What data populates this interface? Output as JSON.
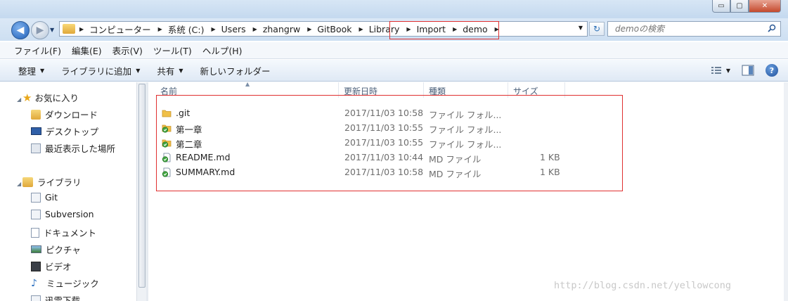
{
  "window": {
    "min_glyph": "▭",
    "max_glyph": "▢",
    "close_glyph": "✕"
  },
  "nav": {
    "back_glyph": "◀",
    "forward_glyph": "▶",
    "history_glyph": "▼",
    "refresh_glyph": "↻"
  },
  "address": {
    "crumbs": [
      "コンピューター",
      "系统 (C:)",
      "Users",
      "zhangrw",
      "GitBook",
      "Library",
      "Import",
      "demo"
    ],
    "dropdown_glyph": "▼"
  },
  "search": {
    "placeholder": "demoの検索"
  },
  "menu": [
    "ファイル(F)",
    "編集(E)",
    "表示(V)",
    "ツール(T)",
    "ヘルプ(H)"
  ],
  "toolbar": {
    "organize": "整理",
    "add_to_library": "ライブラリに追加",
    "share": "共有",
    "new_folder": "新しいフォルダー",
    "dropdown_glyph": "▼",
    "help_glyph": "?"
  },
  "sidebar": {
    "favorites": {
      "label": "お気に入り",
      "items": [
        "ダウンロード",
        "デスクトップ",
        "最近表示した場所"
      ]
    },
    "libraries": {
      "label": "ライブラリ",
      "items": [
        "Git",
        "Subversion",
        "ドキュメント",
        "ピクチャ",
        "ビデオ",
        "ミュージック",
        "迅雷下载"
      ]
    }
  },
  "columns": {
    "name": "名前",
    "date": "更新日時",
    "type": "種類",
    "size": "サイズ",
    "sort_glyph": "▲"
  },
  "files": [
    {
      "name": ".git",
      "date": "2017/11/03 10:58",
      "type": "ファイル フォル...",
      "size": "",
      "icon": "folder-icon"
    },
    {
      "name": "第一章",
      "date": "2017/11/03 10:55",
      "type": "ファイル フォル...",
      "size": "",
      "icon": "folder-synced-icon"
    },
    {
      "name": "第二章",
      "date": "2017/11/03 10:55",
      "type": "ファイル フォル...",
      "size": "",
      "icon": "folder-synced-icon"
    },
    {
      "name": "README.md",
      "date": "2017/11/03 10:44",
      "type": "MD ファイル",
      "size": "1 KB",
      "icon": "file-synced-icon"
    },
    {
      "name": "SUMMARY.md",
      "date": "2017/11/03 10:58",
      "type": "MD ファイル",
      "size": "1 KB",
      "icon": "file-synced-icon"
    }
  ],
  "watermark": "http://blog.csdn.net/yellowcong",
  "colors": {
    "highlight_border": "#e03030",
    "folder": "#f0c048",
    "sync_green": "#3fa33f"
  }
}
